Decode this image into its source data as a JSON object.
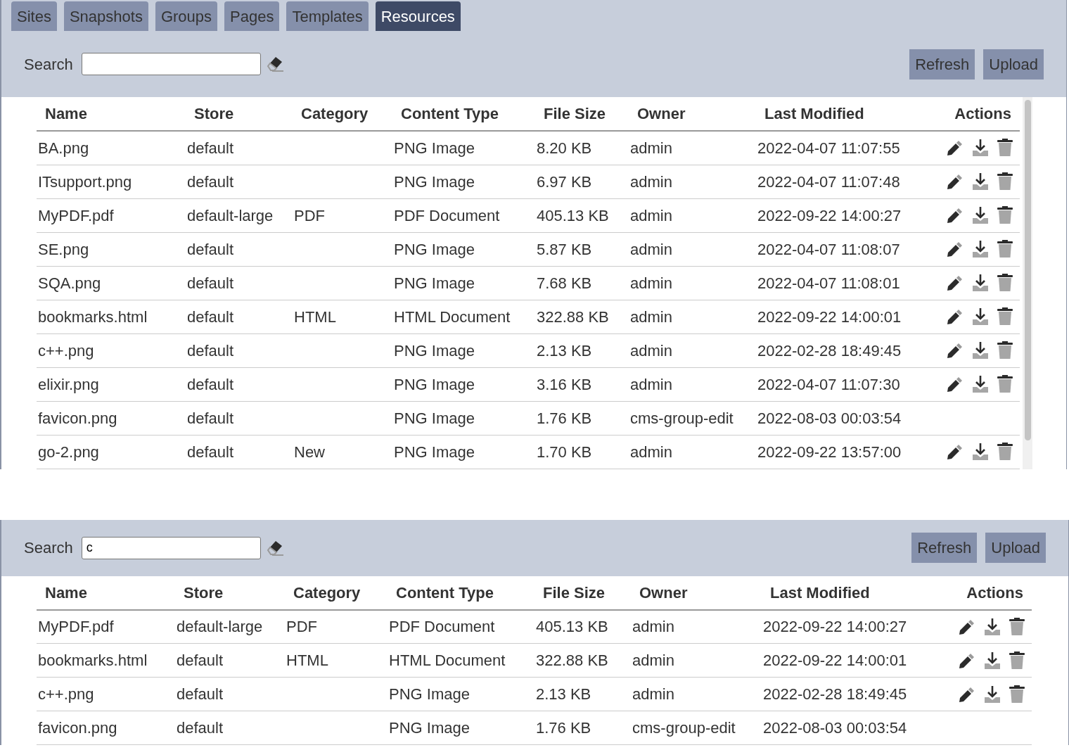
{
  "tabs": [
    {
      "label": "Sites",
      "selected": false
    },
    {
      "label": "Snapshots",
      "selected": false
    },
    {
      "label": "Groups",
      "selected": false
    },
    {
      "label": "Pages",
      "selected": false
    },
    {
      "label": "Templates",
      "selected": false
    },
    {
      "label": "Resources",
      "selected": true
    }
  ],
  "panels": [
    {
      "search": {
        "label": "Search"
      },
      "buttons": [
        "Refresh",
        "Upload"
      ],
      "columns": [
        "Name",
        "Store",
        "Category",
        "Content Type",
        "File Size",
        "Owner",
        "Last Modified",
        "Actions"
      ],
      "rows": [
        {
          "cells": [
            "BA.png",
            "default",
            "",
            "PNG Image",
            "8.20 KB",
            "admin",
            "2022-04-07 11:07:55"
          ],
          "actions": true
        },
        {
          "cells": [
            "ITsupport.png",
            "default",
            "",
            "PNG Image",
            "6.97 KB",
            "admin",
            "2022-04-07 11:07:48"
          ],
          "actions": true
        },
        {
          "cells": [
            "MyPDF.pdf",
            "default-large",
            "PDF",
            "PDF Document",
            "405.13 KB",
            "admin",
            "2022-09-22 14:00:27"
          ],
          "actions": true
        },
        {
          "cells": [
            "SE.png",
            "default",
            "",
            "PNG Image",
            "5.87 KB",
            "admin",
            "2022-04-07 11:08:07"
          ],
          "actions": true
        },
        {
          "cells": [
            "SQA.png",
            "default",
            "",
            "PNG Image",
            "7.68 KB",
            "admin",
            "2022-04-07 11:08:01"
          ],
          "actions": true
        },
        {
          "cells": [
            "bookmarks.html",
            "default",
            "HTML",
            "HTML Document",
            "322.88 KB",
            "admin",
            "2022-09-22 14:00:01"
          ],
          "actions": true
        },
        {
          "cells": [
            "c++.png",
            "default",
            "",
            "PNG Image",
            "2.13 KB",
            "admin",
            "2022-02-28 18:49:45"
          ],
          "actions": true
        },
        {
          "cells": [
            "elixir.png",
            "default",
            "",
            "PNG Image",
            "3.16 KB",
            "admin",
            "2022-04-07 11:07:30"
          ],
          "actions": true
        },
        {
          "cells": [
            "favicon.png",
            "default",
            "",
            "PNG Image",
            "1.76 KB",
            "cms-group-edit",
            "2022-08-03 00:03:54"
          ],
          "actions": false
        },
        {
          "cells": [
            "go-2.png",
            "default",
            "New",
            "PNG Image",
            "1.70 KB",
            "admin",
            "2022-09-22 13:57:00"
          ],
          "actions": true
        }
      ]
    },
    {
      "search": {
        "label": "Search",
        "value": "c"
      },
      "buttons": [
        "Refresh",
        "Upload"
      ],
      "columns": [
        "Name",
        "Store",
        "Category",
        "Content Type",
        "File Size",
        "Owner",
        "Last Modified",
        "Actions"
      ],
      "rows": [
        {
          "cells": [
            "MyPDF.pdf",
            "default-large",
            "PDF",
            "PDF Document",
            "405.13 KB",
            "admin",
            "2022-09-22 14:00:27"
          ],
          "actions": true
        },
        {
          "cells": [
            "bookmarks.html",
            "default",
            "HTML",
            "HTML Document",
            "322.88 KB",
            "admin",
            "2022-09-22 14:00:01"
          ],
          "actions": true
        },
        {
          "cells": [
            "c++.png",
            "default",
            "",
            "PNG Image",
            "2.13 KB",
            "admin",
            "2022-02-28 18:49:45"
          ],
          "actions": true
        },
        {
          "cells": [
            "favicon.png",
            "default",
            "",
            "PNG Image",
            "1.76 KB",
            "cms-group-edit",
            "2022-08-03 00:03:54"
          ],
          "actions": false
        }
      ]
    }
  ]
}
